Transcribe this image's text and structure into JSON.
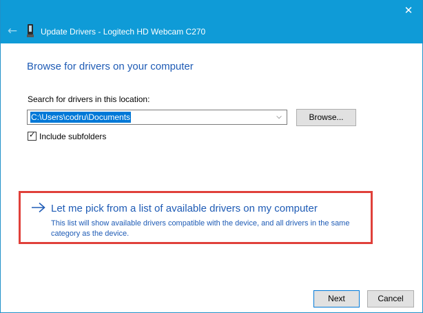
{
  "window": {
    "close_glyph": "✕"
  },
  "header": {
    "back_glyph": "←",
    "title": "Update Drivers - Logitech HD Webcam C270",
    "icon": "webcam-device-icon"
  },
  "main": {
    "heading": "Browse for drivers on your computer",
    "search_label": "Search for drivers in this location:",
    "path_value": "C:\\Users\\codru\\Documents",
    "combo_arrow_glyph": "⌵",
    "browse_label": "Browse...",
    "include_subfolders_label": "Include subfolders",
    "include_subfolders_checked": true,
    "check_glyph": "✓"
  },
  "pick": {
    "title": "Let me pick from a list of available drivers on my computer",
    "description": "This list will show available drivers compatible with the device, and all drivers in the same category as the device.",
    "highlight_color": "#e0403a"
  },
  "footer": {
    "next_label": "Next",
    "cancel_label": "Cancel"
  },
  "colors": {
    "accent": "#0f9bd7",
    "link_blue": "#1e5bb5",
    "selection": "#0078d7"
  }
}
